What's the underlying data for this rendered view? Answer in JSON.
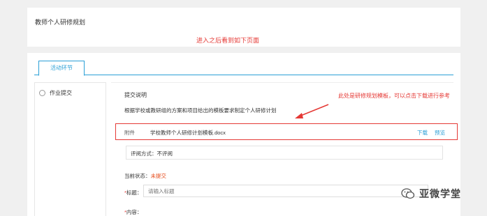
{
  "page": {
    "title": "教师个人研修规划"
  },
  "annotations": {
    "top_note": "进入之后看到如下页面",
    "side_note": "此处是研修规划模板，可以点击下载进行参考"
  },
  "tabs": [
    {
      "label": "活动环节"
    }
  ],
  "sidebar": {
    "items": [
      {
        "label": "作业提交"
      }
    ]
  },
  "submission": {
    "section_title": "提交说明",
    "description": "根据学校或教研组的方案和项目给出的模板要求制定个人研修计划",
    "attachment": {
      "label": "附件",
      "file_name": "学校教师个人研修计划模板.docx",
      "download_label": "下载",
      "preview_label": "预览"
    },
    "review_mode": "评阅方式：不评阅",
    "status_label": "当前状态：",
    "status_value": "未提交",
    "title_label": "标题：",
    "title_placeholder": "请输入标题",
    "content_label": "内容："
  },
  "watermark": {
    "text": "亚微学堂",
    "icon": "wechat-icon"
  },
  "colors": {
    "accent": "#2a9fd6",
    "annotation": "#e53935",
    "status": "#e64a19"
  }
}
